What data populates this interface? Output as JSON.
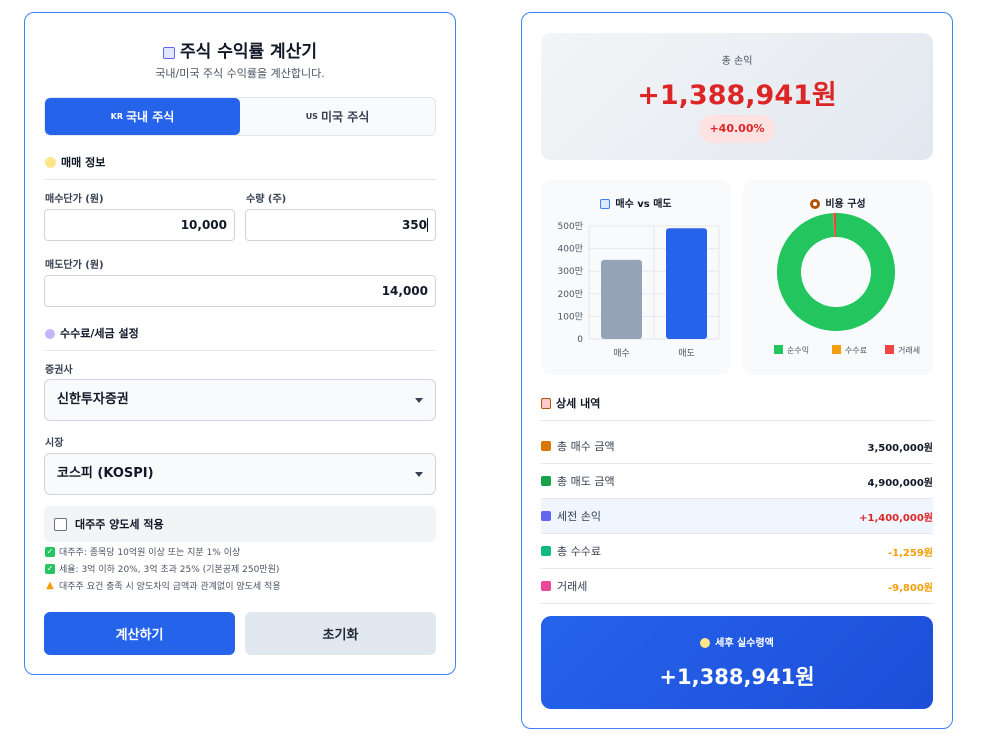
{
  "app": {
    "title": "주식 수익률 계산기",
    "subtitle": "국내/미국 주식 수익률을 계산합니다."
  },
  "tabs": [
    {
      "flag": "KR",
      "label": "국내 주식",
      "active": true
    },
    {
      "flag": "US",
      "label": "미국 주식",
      "active": false
    }
  ],
  "trade": {
    "section_title": "매매 정보",
    "buy_price_label": "매수단가 (원)",
    "buy_price_value": "10,000",
    "quantity_label": "수량 (주)",
    "quantity_value": "350",
    "sell_price_label": "매도단가 (원)",
    "sell_price_value": "14,000"
  },
  "fees": {
    "section_title": "수수료/세금 설정",
    "broker_label": "증권사",
    "broker_value": "신한투자증권",
    "market_label": "시장",
    "market_value": "코스피 (KOSPI)",
    "major_holder_label": "대주주 양도세 적용",
    "notes": [
      "대주주: 종목당 10억원 이상 또는 지분 1% 이상",
      "세율: 3억 이하 20%, 3억 초과 25% (기본공제 250만원)",
      "대주주 요건 충족 시 양도차익 금액과 관계없이 양도세 적용"
    ]
  },
  "buttons": {
    "calculate": "계산하기",
    "reset": "초기화"
  },
  "summary": {
    "total_label": "총 손익",
    "total_value": "+1,388,941원",
    "total_pct": "+40.00%"
  },
  "chart_data": [
    {
      "type": "bar",
      "title": "매수 vs 매도",
      "categories": [
        "매수",
        "매도"
      ],
      "values": [
        350,
        490
      ],
      "ylim": [
        0,
        500
      ],
      "ytick_labels": [
        "0",
        "100만",
        "200만",
        "300만",
        "400만",
        "500만"
      ],
      "colors": [
        "#94a3b8",
        "#2563eb"
      ]
    },
    {
      "type": "pie",
      "title": "비용 구성",
      "labels": [
        "순수익",
        "수수료",
        "거래세"
      ],
      "values": [
        1388941,
        1259,
        9800
      ],
      "colors": [
        "#22c55e",
        "#f59e0b",
        "#ef4444"
      ],
      "legend": "bottom"
    }
  ],
  "details": {
    "title": "상세 내역",
    "rows": [
      {
        "label": "총 매수 금액",
        "value": "3,500,000원",
        "tone": "normal",
        "icon": "money-bag-icon",
        "icon_color": "#d97706"
      },
      {
        "label": "총 매도 금액",
        "value": "4,900,000원",
        "tone": "normal",
        "icon": "cash-icon",
        "icon_color": "#16a34a"
      },
      {
        "label": "세전 손익",
        "value": "+1,400,000원",
        "tone": "red",
        "icon": "chart-up-icon",
        "icon_color": "#6366f1"
      },
      {
        "label": "총 수수료",
        "value": "-1,259원",
        "tone": "orange",
        "icon": "flying-money-icon",
        "icon_color": "#10b981"
      },
      {
        "label": "거래세",
        "value": "-9,800원",
        "tone": "orange",
        "icon": "chart-down-icon",
        "icon_color": "#ec4899"
      }
    ]
  },
  "net": {
    "label": "세후 실수령액",
    "value": "+1,388,941원"
  }
}
